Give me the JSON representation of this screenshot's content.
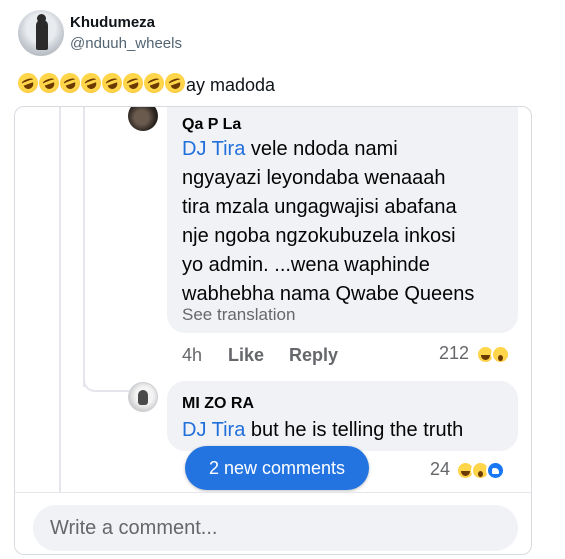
{
  "tweet": {
    "display_name": "Khudumeza",
    "handle": "@nduuh_wheels",
    "emoji_count": 8,
    "emoji_name": "rolling-on-floor-laughing",
    "text": "ay madoda"
  },
  "comments": [
    {
      "author": "Qa P La",
      "mention": "DJ Tira",
      "lines": [
        " vele ndoda nami",
        "ngyayazi leyondaba wenaaah",
        "tira mzala ungagwajisi abafana",
        "nje ngoba ngzokubuzela inkosi",
        "yo admin. ...wena waphinde",
        "wabhebha nama Qwabe Queens"
      ],
      "see_translation": "See translation",
      "time": "4h",
      "like_label": "Like",
      "reply_label": "Reply",
      "reaction_count": "212",
      "reactions": [
        "haha",
        "wow"
      ]
    },
    {
      "author": "MI ZO RA",
      "mention": "DJ Tira",
      "text": " but he is telling the truth",
      "reaction_count": "24",
      "reactions": [
        "haha",
        "wow",
        "like"
      ]
    }
  ],
  "new_comments_label": "2 new comments",
  "composer": {
    "placeholder": "Write a comment..."
  }
}
